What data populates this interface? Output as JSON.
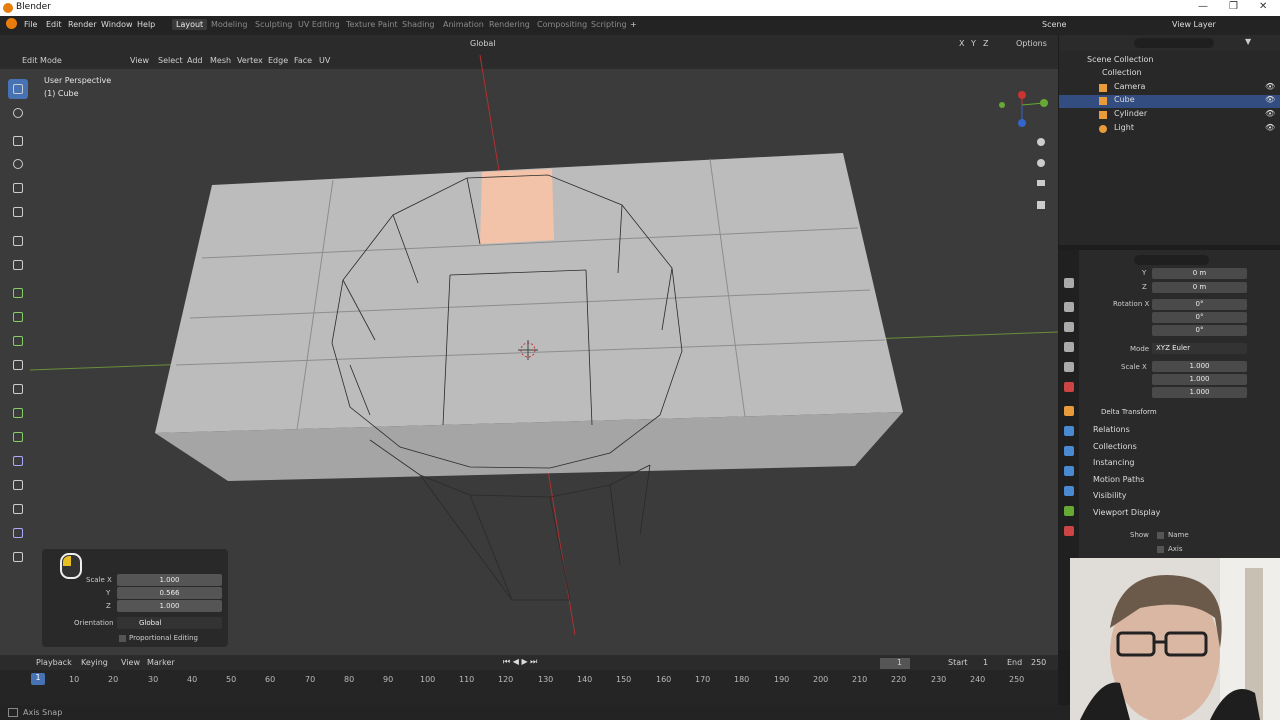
{
  "window": {
    "title": "Blender"
  },
  "menu": [
    "File",
    "Edit",
    "Render",
    "Window",
    "Help"
  ],
  "workspaces": [
    "Layout",
    "Modeling",
    "Sculpting",
    "UV Editing",
    "Texture Paint",
    "Shading",
    "Animation",
    "Rendering",
    "Compositing",
    "Scripting"
  ],
  "active_workspace": "Layout",
  "scene_name": "Scene",
  "view_layer": "View Layer",
  "viewport": {
    "mode": "Edit Mode",
    "header_menus": [
      "View",
      "Select",
      "Add",
      "Mesh",
      "Vertex",
      "Edge",
      "Face",
      "UV"
    ],
    "transform_orientation": "Global",
    "options_label": "Options",
    "axes": [
      "X",
      "Y",
      "Z"
    ],
    "perspective": "User Perspective",
    "object": "(1) Cube"
  },
  "op_panel": {
    "scale_x_label": "Scale X",
    "scale_x": "1.000",
    "y_label": "Y",
    "y": "0.566",
    "z_label": "Z",
    "z": "1.000",
    "orientation_label": "Orientation",
    "orientation": "Global",
    "proportional": "Proportional Editing"
  },
  "timeline": {
    "menus": [
      "Playback",
      "Keying",
      "View",
      "Marker"
    ],
    "current_frame": "1",
    "start_label": "Start",
    "start": "1",
    "end_label": "End",
    "end": "250",
    "ticks": [
      "10",
      "20",
      "30",
      "40",
      "50",
      "60",
      "70",
      "80",
      "90",
      "100",
      "110",
      "120",
      "130",
      "140",
      "150",
      "160",
      "170",
      "180",
      "190",
      "200",
      "210",
      "220",
      "230",
      "240",
      "250"
    ],
    "playhead": "1"
  },
  "outliner": {
    "root": "Scene Collection",
    "collection": "Collection",
    "items": [
      "Camera",
      "Cube",
      "Cylinder",
      "Light"
    ],
    "selected": "Cube"
  },
  "properties": {
    "y_label": "Y",
    "y_loc": "0 m",
    "z_label": "Z",
    "z_loc": "0 m",
    "rot_x_label": "Rotation X",
    "rot_x": "0°",
    "rot_y": "0°",
    "rot_z": "0°",
    "mode_label": "Mode",
    "mode": "XYZ Euler",
    "scale_x_label": "Scale X",
    "scale_x": "1.000",
    "scale_y": "1.000",
    "scale_z": "1.000",
    "sections": [
      "Delta Transform",
      "Relations",
      "Collections",
      "Instancing",
      "Motion Paths",
      "Visibility",
      "Viewport Display"
    ],
    "show_label": "Show",
    "name_label": "Name",
    "axis_label": "Axis"
  },
  "status": {
    "text": "Axis Snap"
  },
  "colors": {
    "accent": "#4772b3",
    "selected_face": "#f2c3a8",
    "x_axis": "#c44",
    "y_axis": "#6a3"
  }
}
